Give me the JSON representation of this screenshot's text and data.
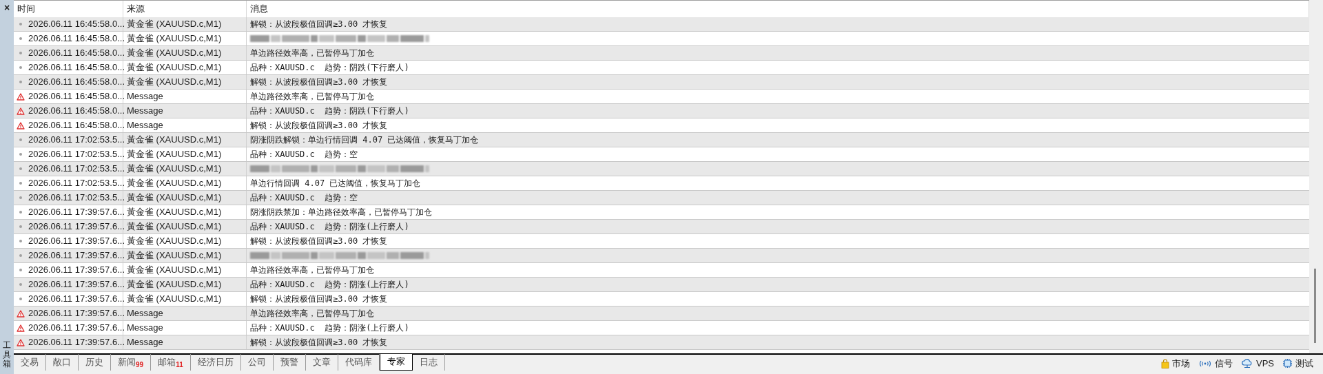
{
  "sidebar": {
    "close": "×",
    "title": "工具箱"
  },
  "table": {
    "columns": [
      "时间",
      "来源",
      "消息"
    ],
    "rows": [
      {
        "kind": "info",
        "time": "2026.06.11 16:45:58.0...",
        "source": "黃金雀 (XAUUSD.c,M1)",
        "message": "解锁：从波段极值回调≥3.00 才恢复"
      },
      {
        "kind": "info",
        "time": "2026.06.11 16:45:58.0...",
        "source": "黃金雀 (XAUUSD.c,M1)",
        "blurred": true
      },
      {
        "kind": "info",
        "time": "2026.06.11 16:45:58.0...",
        "source": "黃金雀 (XAUUSD.c,M1)",
        "message": "单边路径效率高，已暂停马丁加仓"
      },
      {
        "kind": "info",
        "time": "2026.06.11 16:45:58.0...",
        "source": "黃金雀 (XAUUSD.c,M1)",
        "message": "品种：XAUUSD.c  趋势：阴跌(下行磨人)"
      },
      {
        "kind": "info",
        "time": "2026.06.11 16:45:58.0...",
        "source": "黃金雀 (XAUUSD.c,M1)",
        "message": "解锁：从波段极值回调≥3.00 才恢复"
      },
      {
        "kind": "warning",
        "time": "2026.06.11 16:45:58.0...",
        "source": "Message",
        "message": "单边路径效率高，已暂停马丁加仓"
      },
      {
        "kind": "warning",
        "time": "2026.06.11 16:45:58.0...",
        "source": "Message",
        "message": "品种：XAUUSD.c  趋势：阴跌(下行磨人)"
      },
      {
        "kind": "warning",
        "time": "2026.06.11 16:45:58.0...",
        "source": "Message",
        "message": "解锁：从波段极值回调≥3.00 才恢复"
      },
      {
        "kind": "info",
        "time": "2026.06.11 17:02:53.5...",
        "source": "黃金雀 (XAUUSD.c,M1)",
        "message": "阴涨阴跌解锁：单边行情回调 4.07 已达阈值，恢复马丁加仓"
      },
      {
        "kind": "info",
        "time": "2026.06.11 17:02:53.5...",
        "source": "黃金雀 (XAUUSD.c,M1)",
        "message": "品种：XAUUSD.c  趋势：空"
      },
      {
        "kind": "info",
        "time": "2026.06.11 17:02:53.5...",
        "source": "黃金雀 (XAUUSD.c,M1)",
        "blurred": true
      },
      {
        "kind": "info",
        "time": "2026.06.11 17:02:53.5...",
        "source": "黃金雀 (XAUUSD.c,M1)",
        "message": "单边行情回调 4.07 已达阈值，恢复马丁加仓"
      },
      {
        "kind": "info",
        "time": "2026.06.11 17:02:53.5...",
        "source": "黃金雀 (XAUUSD.c,M1)",
        "message": "品种：XAUUSD.c  趋势：空"
      },
      {
        "kind": "info",
        "time": "2026.06.11 17:39:57.6...",
        "source": "黃金雀 (XAUUSD.c,M1)",
        "message": "阴涨阴跌禁加：单边路径效率高，已暂停马丁加仓"
      },
      {
        "kind": "info",
        "time": "2026.06.11 17:39:57.6...",
        "source": "黃金雀 (XAUUSD.c,M1)",
        "message": "品种：XAUUSD.c  趋势：阴涨(上行磨人)"
      },
      {
        "kind": "info",
        "time": "2026.06.11 17:39:57.6...",
        "source": "黃金雀 (XAUUSD.c,M1)",
        "message": "解锁：从波段极值回调≥3.00 才恢复"
      },
      {
        "kind": "info",
        "time": "2026.06.11 17:39:57.6...",
        "source": "黃金雀 (XAUUSD.c,M1)",
        "blurred": true
      },
      {
        "kind": "info",
        "time": "2026.06.11 17:39:57.6...",
        "source": "黃金雀 (XAUUSD.c,M1)",
        "message": "单边路径效率高，已暂停马丁加仓"
      },
      {
        "kind": "info",
        "time": "2026.06.11 17:39:57.6...",
        "source": "黃金雀 (XAUUSD.c,M1)",
        "message": "品种：XAUUSD.c  趋势：阴涨(上行磨人)"
      },
      {
        "kind": "info",
        "time": "2026.06.11 17:39:57.6...",
        "source": "黃金雀 (XAUUSD.c,M1)",
        "message": "解锁：从波段极值回调≥3.00 才恢复"
      },
      {
        "kind": "warning",
        "time": "2026.06.11 17:39:57.6...",
        "source": "Message",
        "message": "单边路径效率高，已暂停马丁加仓"
      },
      {
        "kind": "warning",
        "time": "2026.06.11 17:39:57.6...",
        "source": "Message",
        "message": "品种：XAUUSD.c  趋势：阴涨(上行磨人)"
      },
      {
        "kind": "warning",
        "time": "2026.06.11 17:39:57.6...",
        "source": "Message",
        "message": "解锁：从波段极值回调≥3.00 才恢复"
      }
    ]
  },
  "tabs": [
    {
      "label": "交易",
      "selected": false
    },
    {
      "label": "敞口",
      "selected": false
    },
    {
      "label": "历史",
      "selected": false
    },
    {
      "label": "新闻",
      "badge": "99",
      "selected": false
    },
    {
      "label": "邮箱",
      "badge": "11",
      "selected": false
    },
    {
      "label": "经济日历",
      "selected": false
    },
    {
      "label": "公司",
      "selected": false
    },
    {
      "label": "预警",
      "selected": false
    },
    {
      "label": "文章",
      "selected": false
    },
    {
      "label": "代码库",
      "selected": false
    },
    {
      "label": "专家",
      "selected": true
    },
    {
      "label": "日志",
      "selected": false
    }
  ],
  "status_bar": [
    {
      "kind": "market",
      "label": "市场"
    },
    {
      "kind": "signals",
      "label": "信号"
    },
    {
      "kind": "vps",
      "label": "VPS"
    },
    {
      "kind": "tester",
      "label": "测试"
    }
  ]
}
